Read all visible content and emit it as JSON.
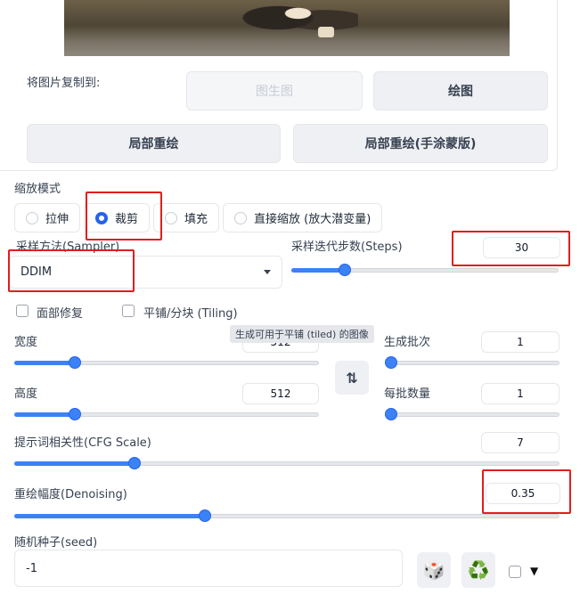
{
  "copy_to": {
    "label": "将图片复制到:",
    "img2img": "图生图",
    "sketch": "绘图",
    "inpaint": "局部重绘",
    "inpaint_sketch": "局部重绘(手涂蒙版)"
  },
  "resize_mode": {
    "label": "缩放模式",
    "options": [
      "拉伸",
      "裁剪",
      "填充",
      "直接缩放 (放大潜变量)"
    ],
    "selected": "裁剪"
  },
  "sampler": {
    "label": "采样方法(Sampler)",
    "value": "DDIM"
  },
  "steps": {
    "label": "采样迭代步数(Steps)",
    "value": "30",
    "fraction": 0.2
  },
  "face_restore": {
    "label": "面部修复"
  },
  "tiling": {
    "label": "平铺/分块 (Tiling)",
    "tooltip": "生成可用于平铺 (tiled) 的图像"
  },
  "width": {
    "label": "宽度",
    "value": "512",
    "fraction": 0.2
  },
  "height": {
    "label": "高度",
    "value": "512",
    "fraction": 0.2
  },
  "swap_icon": "⇅",
  "batch_count": {
    "label": "生成批次",
    "value": "1",
    "fraction": 0.0
  },
  "batch_size": {
    "label": "每批数量",
    "value": "1",
    "fraction": 0.0
  },
  "cfg": {
    "label": "提示词相关性(CFG Scale)",
    "value": "7",
    "fraction": 0.22
  },
  "denoising": {
    "label": "重绘幅度(Denoising)",
    "value": "0.35",
    "fraction": 0.35
  },
  "seed": {
    "label": "随机种子(seed)",
    "value": "-1",
    "dice_icon": "🎲",
    "recycle_icon": "♻️",
    "dropdown_icon": "▼"
  },
  "colors": {
    "accent": "#3b82f6",
    "highlight": "#e01e1e"
  }
}
